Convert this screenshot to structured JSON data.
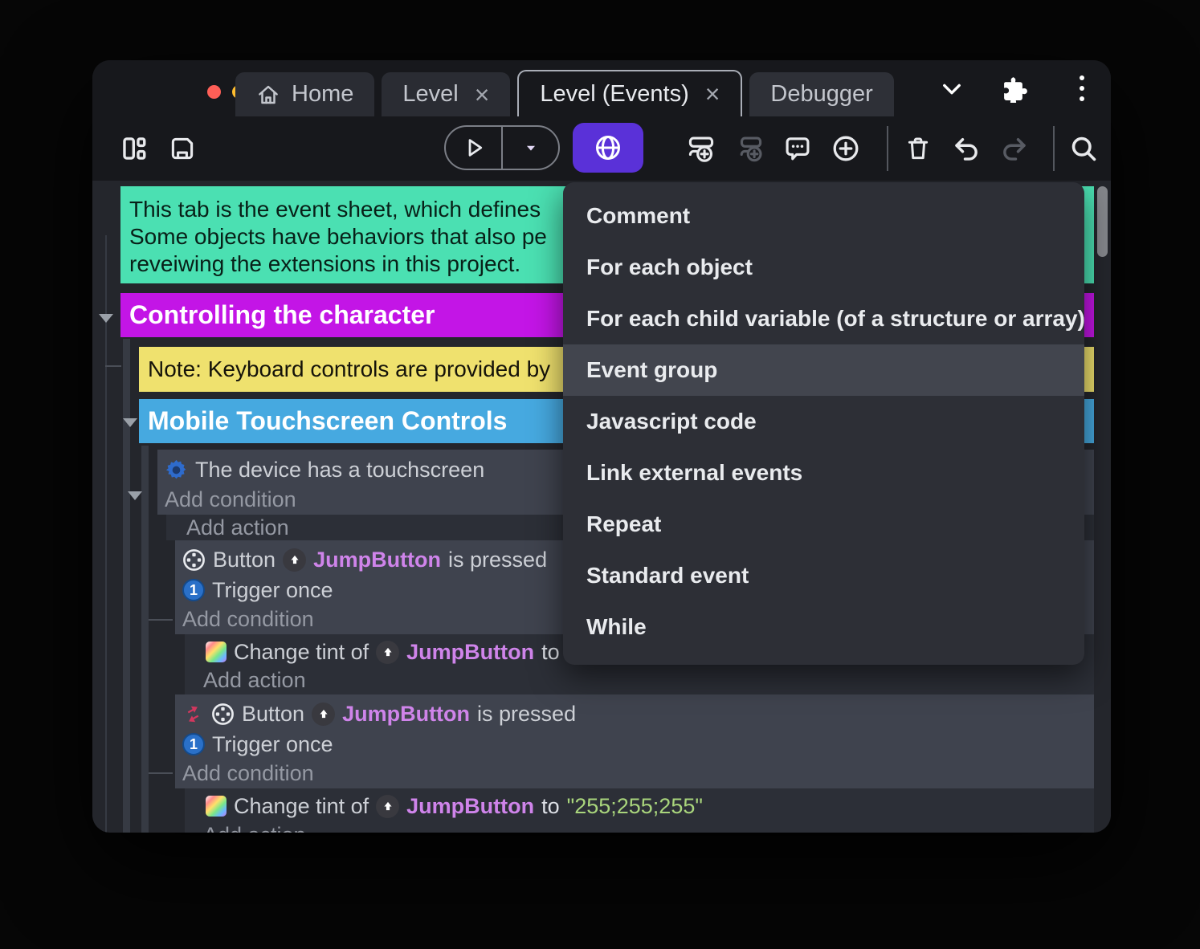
{
  "titlebar": {
    "tabs": [
      {
        "label": "Home"
      },
      {
        "label": "Level"
      },
      {
        "label": "Level (Events)"
      },
      {
        "label": "Debugger"
      }
    ],
    "close_glyph": "×"
  },
  "menu": {
    "items": [
      "Comment",
      "For each object",
      "For each child variable (of a structure or array)",
      "Event group",
      "Javascript code",
      "Link external events",
      "Repeat",
      "Standard event",
      "While"
    ],
    "highlighted_item": "Event group"
  },
  "sheet": {
    "comment_line1": "This tab is the event sheet, which defines",
    "comment_line2": "Some objects have behaviors that also pe",
    "comment_line3": "reveiwing the extensions in this project.",
    "group_controlling": "Controlling the character",
    "note": "Note: Keyboard controls are provided by",
    "group_mobile": "Mobile Touchscreen Controls",
    "add_condition": "Add condition",
    "add_action": "Add action",
    "device_condition": "The device has a touchscreen",
    "button_object": "Button",
    "instance": "JumpButton",
    "pressed_suffix": "is pressed",
    "trigger_once": "Trigger once",
    "trigger_once_num": "1",
    "tint_prefix": "Change tint of",
    "to_word": "to",
    "tint_value": "\"255;255;255\""
  },
  "colors": {
    "accent_purple": "#5a31d8",
    "comment_teal": "#4be0b2",
    "group_magenta": "#c315e6",
    "note_yellow": "#efe16e",
    "group_blue": "#46a9e0",
    "instance_text": "#cf84ea",
    "string_green": "#a9d57c",
    "traffic_red": "#ff5f57",
    "traffic_yellow": "#febc2e",
    "traffic_green": "#28c840"
  }
}
